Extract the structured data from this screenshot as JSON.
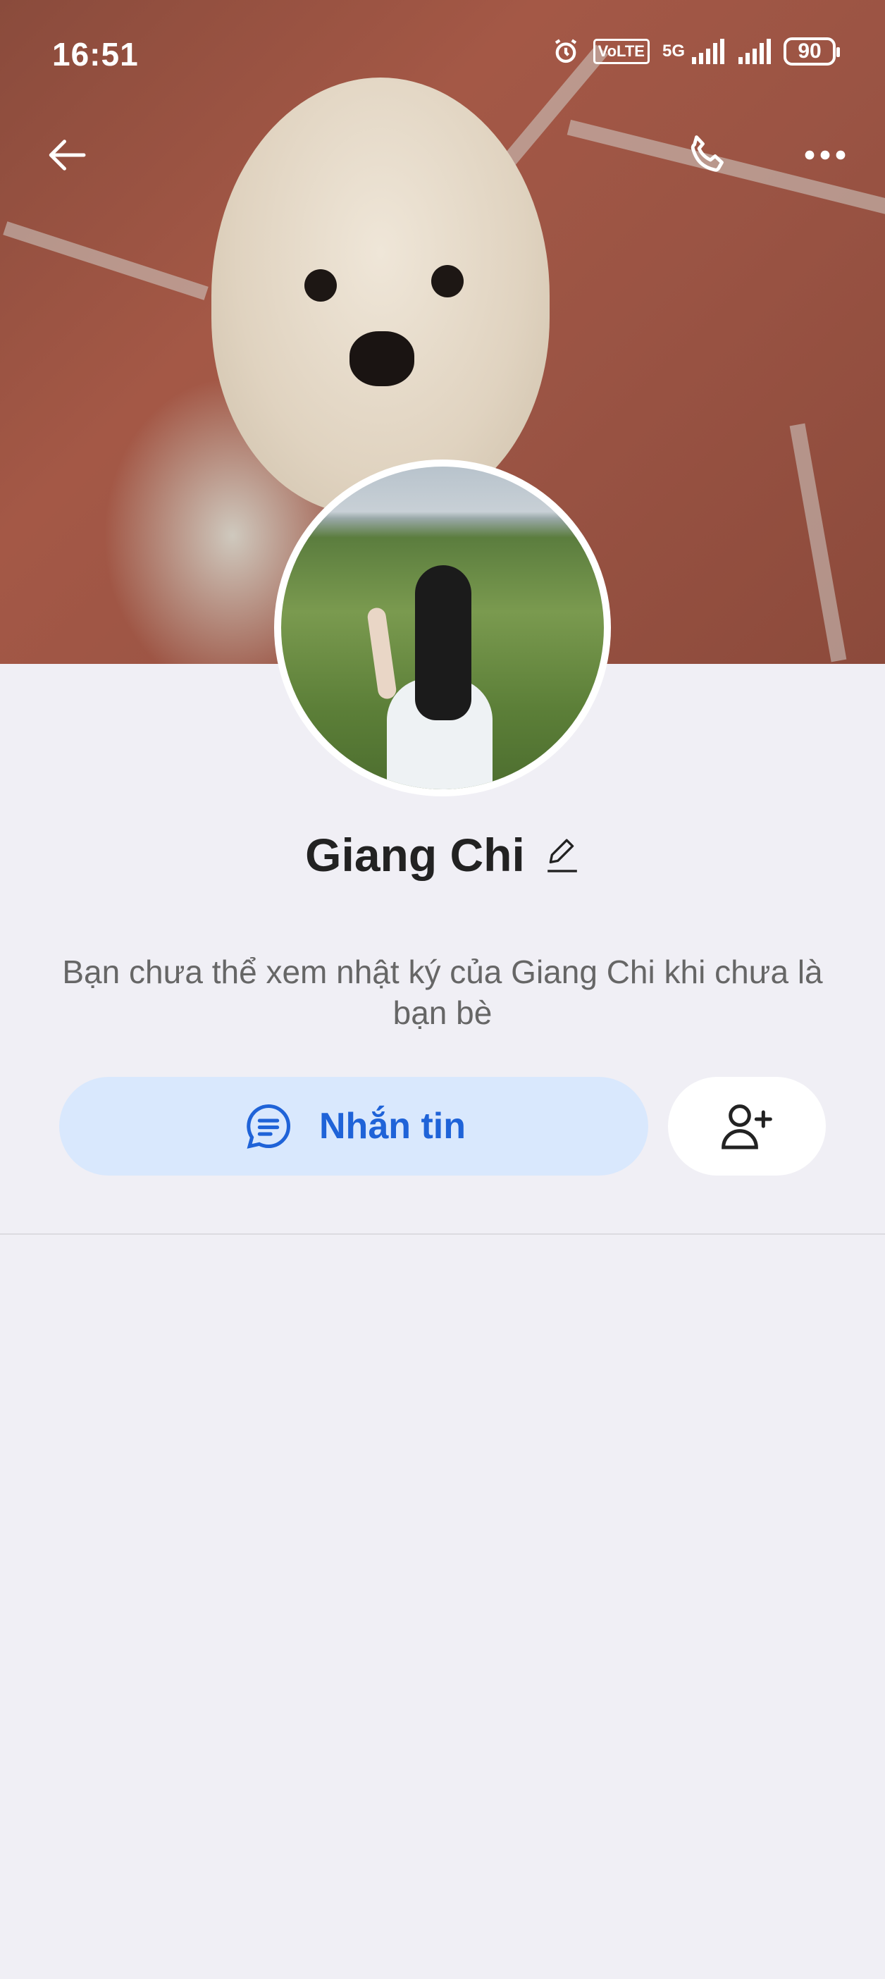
{
  "status_bar": {
    "time": "16:51",
    "network_badge": "VoLTE",
    "network_type": "5G",
    "battery": "90"
  },
  "header": {
    "back_icon": "arrow-left-icon",
    "call_icon": "phone-icon",
    "more_icon": "more-horizontal-icon"
  },
  "profile": {
    "name": "Giang Chi",
    "edit_icon": "pencil-icon",
    "subtitle": "Bạn chưa thể xem nhật ký của Giang Chi khi chưa là bạn bè"
  },
  "actions": {
    "message_label": "Nhắn tin",
    "message_icon": "chat-bubble-icon",
    "add_friend_icon": "add-user-icon"
  },
  "colors": {
    "accent": "#1f63d8",
    "message_button_bg": "#d9e8fd",
    "page_bg": "#f0eff5"
  }
}
